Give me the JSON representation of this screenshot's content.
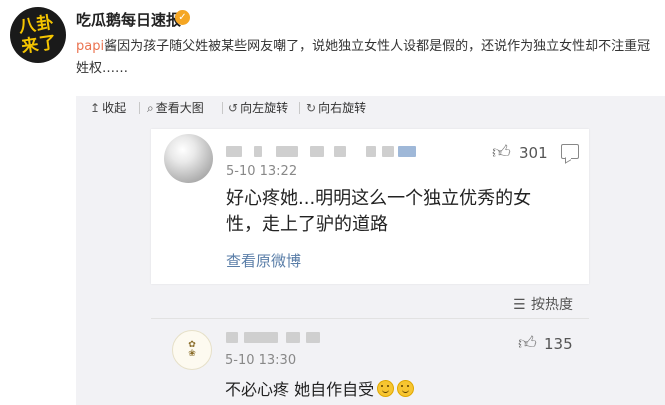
{
  "post": {
    "author": "吃瓜鹅每日速报",
    "avatar_text": "八卦来了",
    "mention": "papi",
    "text": "酱因为孩子随父姓被某些网友嘲了，说她独立女性人设都是假的，还说作为独立女性却不注重冠姓权……"
  },
  "toolbar": {
    "collapse": "收起",
    "view_large": "查看大图",
    "rotate_left": "向左旋转",
    "rotate_right": "向右旋转"
  },
  "comment1": {
    "time": "5-10 13:22",
    "text": "好心疼她...明明这么一个独立优秀的女性，走上了驴的道路",
    "likes": "301",
    "source_link": "查看原微博"
  },
  "sort": {
    "label": "按热度"
  },
  "comment2": {
    "time": "5-10 13:30",
    "text": "不必心疼 她自作自受",
    "likes": "135"
  },
  "icons": [
    "verified-icon",
    "collapse-icon",
    "search-icon",
    "rotate-left-icon",
    "rotate-right-icon",
    "thumbs-up-icon",
    "reply-icon",
    "sort-icon",
    "laugh-emoji-icon"
  ],
  "colors": {
    "mention": "#eb7350",
    "link": "#5a7ea8",
    "panel": "#f2f2f5"
  }
}
